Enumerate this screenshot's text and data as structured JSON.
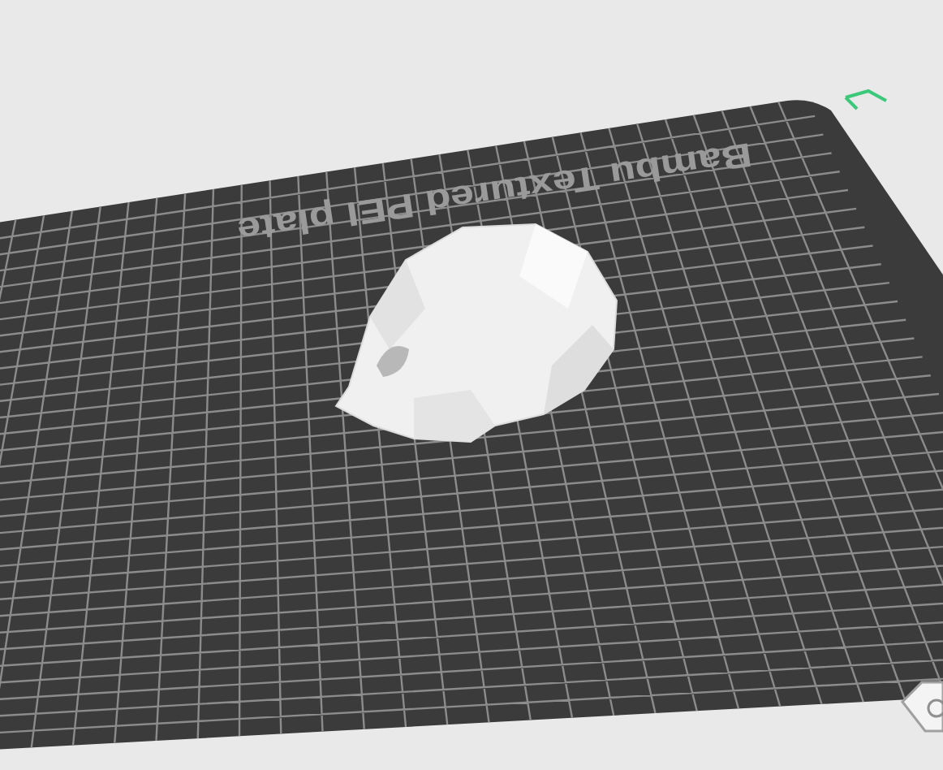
{
  "plate": {
    "label": "Bambu Textured PEI plate"
  }
}
